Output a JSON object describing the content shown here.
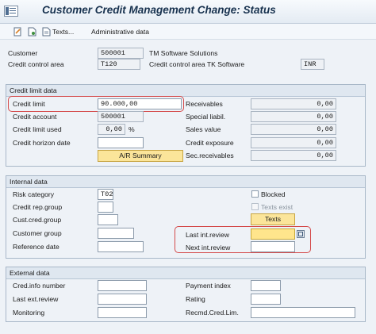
{
  "window": {
    "title": "Customer Credit Management Change: Status"
  },
  "toolbar": {
    "texts_label": "Texts...",
    "admin_label": "Administrative data"
  },
  "header": {
    "customer_label": "Customer",
    "customer_value": "500001",
    "customer_name": "TM Software Solutions",
    "cca_label": "Credit control area",
    "cca_value": "T120",
    "cca_desc": "Credit control area TK Software",
    "currency": "INR"
  },
  "credit_limit_data": {
    "title": "Credit limit data",
    "credit_limit_label": "Credit limit",
    "credit_limit_value": "90.000,00",
    "credit_account_label": "Credit account",
    "credit_account_value": "500001",
    "credit_limit_used_label": "Credit limit used",
    "credit_limit_used_value": "0,00",
    "percent_sign": "%",
    "credit_horizon_label": "Credit horizon date",
    "credit_horizon_value": "",
    "ar_summary_label": "A/R Summary",
    "receivables_label": "Receivables",
    "receivables_value": "0,00",
    "special_liabil_label": "Special liabil.",
    "special_liabil_value": "0,00",
    "sales_value_label": "Sales value",
    "sales_value_value": "0,00",
    "credit_exposure_label": "Credit exposure",
    "credit_exposure_value": "0,00",
    "sec_receivables_label": "Sec.receivables",
    "sec_receivables_value": "0,00"
  },
  "internal_data": {
    "title": "Internal data",
    "risk_category_label": "Risk category",
    "risk_category_value": "T02",
    "credit_rep_group_label": "Credit rep.group",
    "cust_cred_group_label": "Cust.cred.group",
    "customer_group_label": "Customer group",
    "reference_date_label": "Reference date",
    "blocked_label": "Blocked",
    "texts_exist_label": "Texts exist",
    "texts_button_label": "Texts",
    "last_int_review_label": "Last int.review",
    "next_int_review_label": "Next int.review"
  },
  "external_data": {
    "title": "External data",
    "cred_info_number_label": "Cred.info number",
    "last_ext_review_label": "Last ext.review",
    "monitoring_label": "Monitoring",
    "payment_index_label": "Payment index",
    "rating_label": "Rating",
    "recmd_cred_lim_label": "Recmd.Cred.Lim."
  },
  "colors": {
    "title_text": "#18324f",
    "highlight_yellow": "#ffe58c",
    "annotation_red": "#d44a4a",
    "group_header": "#dfe7f0"
  }
}
